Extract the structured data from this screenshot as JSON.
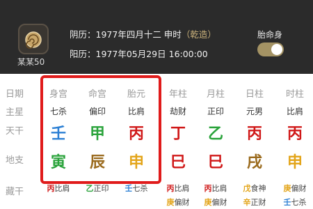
{
  "profile": {
    "name": "某某50",
    "lunar_label": "阴历：",
    "lunar_value": "1977年四月十二 申时",
    "lunar_sub": "（乾造）",
    "solar_label": "阳历：",
    "solar_value": "1977年05月29日 16:00:00",
    "toggle_label": "胎命身",
    "toggle_on": true
  },
  "table": {
    "row_labels": [
      "日期",
      "主星",
      "天干",
      "地支",
      "藏干"
    ],
    "columns": [
      {
        "head": "身宫",
        "star": "七杀",
        "stem": "壬",
        "stem_color": "#2b7fd4",
        "branch": "寅",
        "branch_color": "#2aa33b",
        "hidden": [
          [
            "丙",
            "#d01818",
            "比肩"
          ]
        ]
      },
      {
        "head": "命宫",
        "star": "偏印",
        "stem": "甲",
        "stem_color": "#2aa33b",
        "branch": "辰",
        "branch_color": "#9a6a1d",
        "hidden": [
          [
            "乙",
            "#2aa33b",
            "正印"
          ]
        ]
      },
      {
        "head": "胎元",
        "star": "比肩",
        "stem": "丙",
        "stem_color": "#d01818",
        "branch": "申",
        "branch_color": "#e3a51a",
        "hidden": [
          [
            "壬",
            "#2b7fd4",
            "七杀"
          ]
        ]
      },
      {
        "head": "年柱",
        "star": "劫财",
        "stem": "丁",
        "stem_color": "#d01818",
        "branch": "巳",
        "branch_color": "#d01818",
        "hidden": [
          [
            "丙",
            "#d01818",
            "比肩"
          ],
          [
            "庚",
            "#e3a51a",
            "偏财"
          ]
        ]
      },
      {
        "head": "月柱",
        "star": "正印",
        "stem": "乙",
        "stem_color": "#2aa33b",
        "branch": "巳",
        "branch_color": "#d01818",
        "hidden": [
          [
            "丙",
            "#d01818",
            "比肩"
          ],
          [
            "庚",
            "#e3a51a",
            "偏财"
          ]
        ]
      },
      {
        "head": "日柱",
        "star": "元男",
        "stem": "丙",
        "stem_color": "#d01818",
        "branch": "戌",
        "branch_color": "#9a6a1d",
        "hidden": [
          [
            "戊",
            "#e3a51a",
            "食神"
          ],
          [
            "辛",
            "#e3a51a",
            "正财"
          ]
        ]
      },
      {
        "head": "时柱",
        "star": "比肩",
        "stem": "丙",
        "stem_color": "#d01818",
        "branch": "申",
        "branch_color": "#e3a51a",
        "hidden": [
          [
            "庚",
            "#e3a51a",
            "偏财"
          ],
          [
            "壬",
            "#2b7fd4",
            "七杀"
          ]
        ]
      }
    ]
  }
}
